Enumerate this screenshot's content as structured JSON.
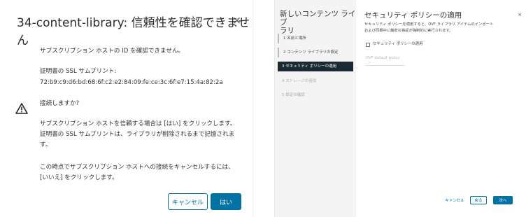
{
  "left_dialog": {
    "title": "34-content-library: 信頼性を確認できません",
    "close_symbol": "×",
    "msg_id": "サブスクリプション ホストの ID を確認できません。",
    "thumbprint_label": "証明書の SSL サムプリント:",
    "thumbprint_value": "72:b9:c9:d6:bd:68:6f:c2:e2:84:09:fe:ce:3c:6f:e7:15:4a:82:2a",
    "connect_question": "接続しますか?",
    "info_line1": "サブスクリプション ホストを信頼する場合は [はい] をクリックします。",
    "info_line2": "証明書の SSL サムプリントは、ライブラリが削除されるまで記憶されま",
    "info_line3": "す。",
    "cancel_line1": "この時点でサブスクリプション ホストへの接続をキャンセルするには、",
    "cancel_line2": "[いいえ] をクリックします。",
    "cancel_button": "キャンセル",
    "yes_button": "はい",
    "warning_icon": "warning-triangle-icon",
    "accent_color": "#0072a3"
  },
  "right_wizard": {
    "sidebar_title_line1": "新しいコンテンツ ライブ",
    "sidebar_title_line2": "ラリ",
    "steps": [
      {
        "label": "1  名前と場所"
      },
      {
        "label": "2  コンテンツ ライブラリの設定"
      },
      {
        "label": "3  セキュリティ ポリシーの適用"
      },
      {
        "label": "4  ストレージの追加"
      },
      {
        "label": "5  設定の確認"
      }
    ],
    "title": "セキュリティ ポリシーの適用",
    "close_symbol": "×",
    "desc_line1": "セキュリティ ポリシーを適用すると、OVF ライブラリ アイテムのインポート",
    "desc_line2": "および同期中に厳密な検証が強制的に実行されます。",
    "checkbox_label": "セキュリティ ポリシーの適用",
    "select_value": "OVF default policy",
    "cancel_button": "キャンセル",
    "back_button": "戻る",
    "next_button": "次へ"
  }
}
